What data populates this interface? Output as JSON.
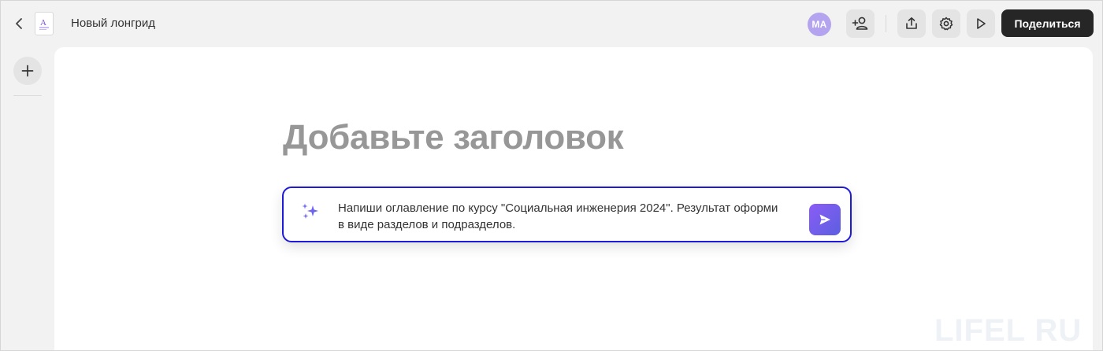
{
  "header": {
    "doc_title": "Новый лонгрид",
    "avatar_initials": "MA",
    "share_label": "Поделиться"
  },
  "editor": {
    "heading_placeholder": "Добавьте заголовок",
    "prompt_text": "Напиши оглавление по курсу \"Социальная инженерия 2024\". Результат оформи в виде разделов и подразделов."
  },
  "watermark": "LIFEL  RU",
  "colors": {
    "accent_border": "#1f1ad6",
    "send_gradient_start": "#8b5cf6",
    "send_gradient_end": "#5b5fe0",
    "avatar_bg": "#b4a3ef",
    "share_bg": "#262626"
  },
  "icons": {
    "back": "chevron-left-icon",
    "doc": "document-icon",
    "add_user": "add-user-icon",
    "export": "upload-icon",
    "settings": "gear-icon",
    "preview": "play-icon",
    "add_block": "plus-icon",
    "ai": "sparkle-icon",
    "send": "send-icon"
  }
}
